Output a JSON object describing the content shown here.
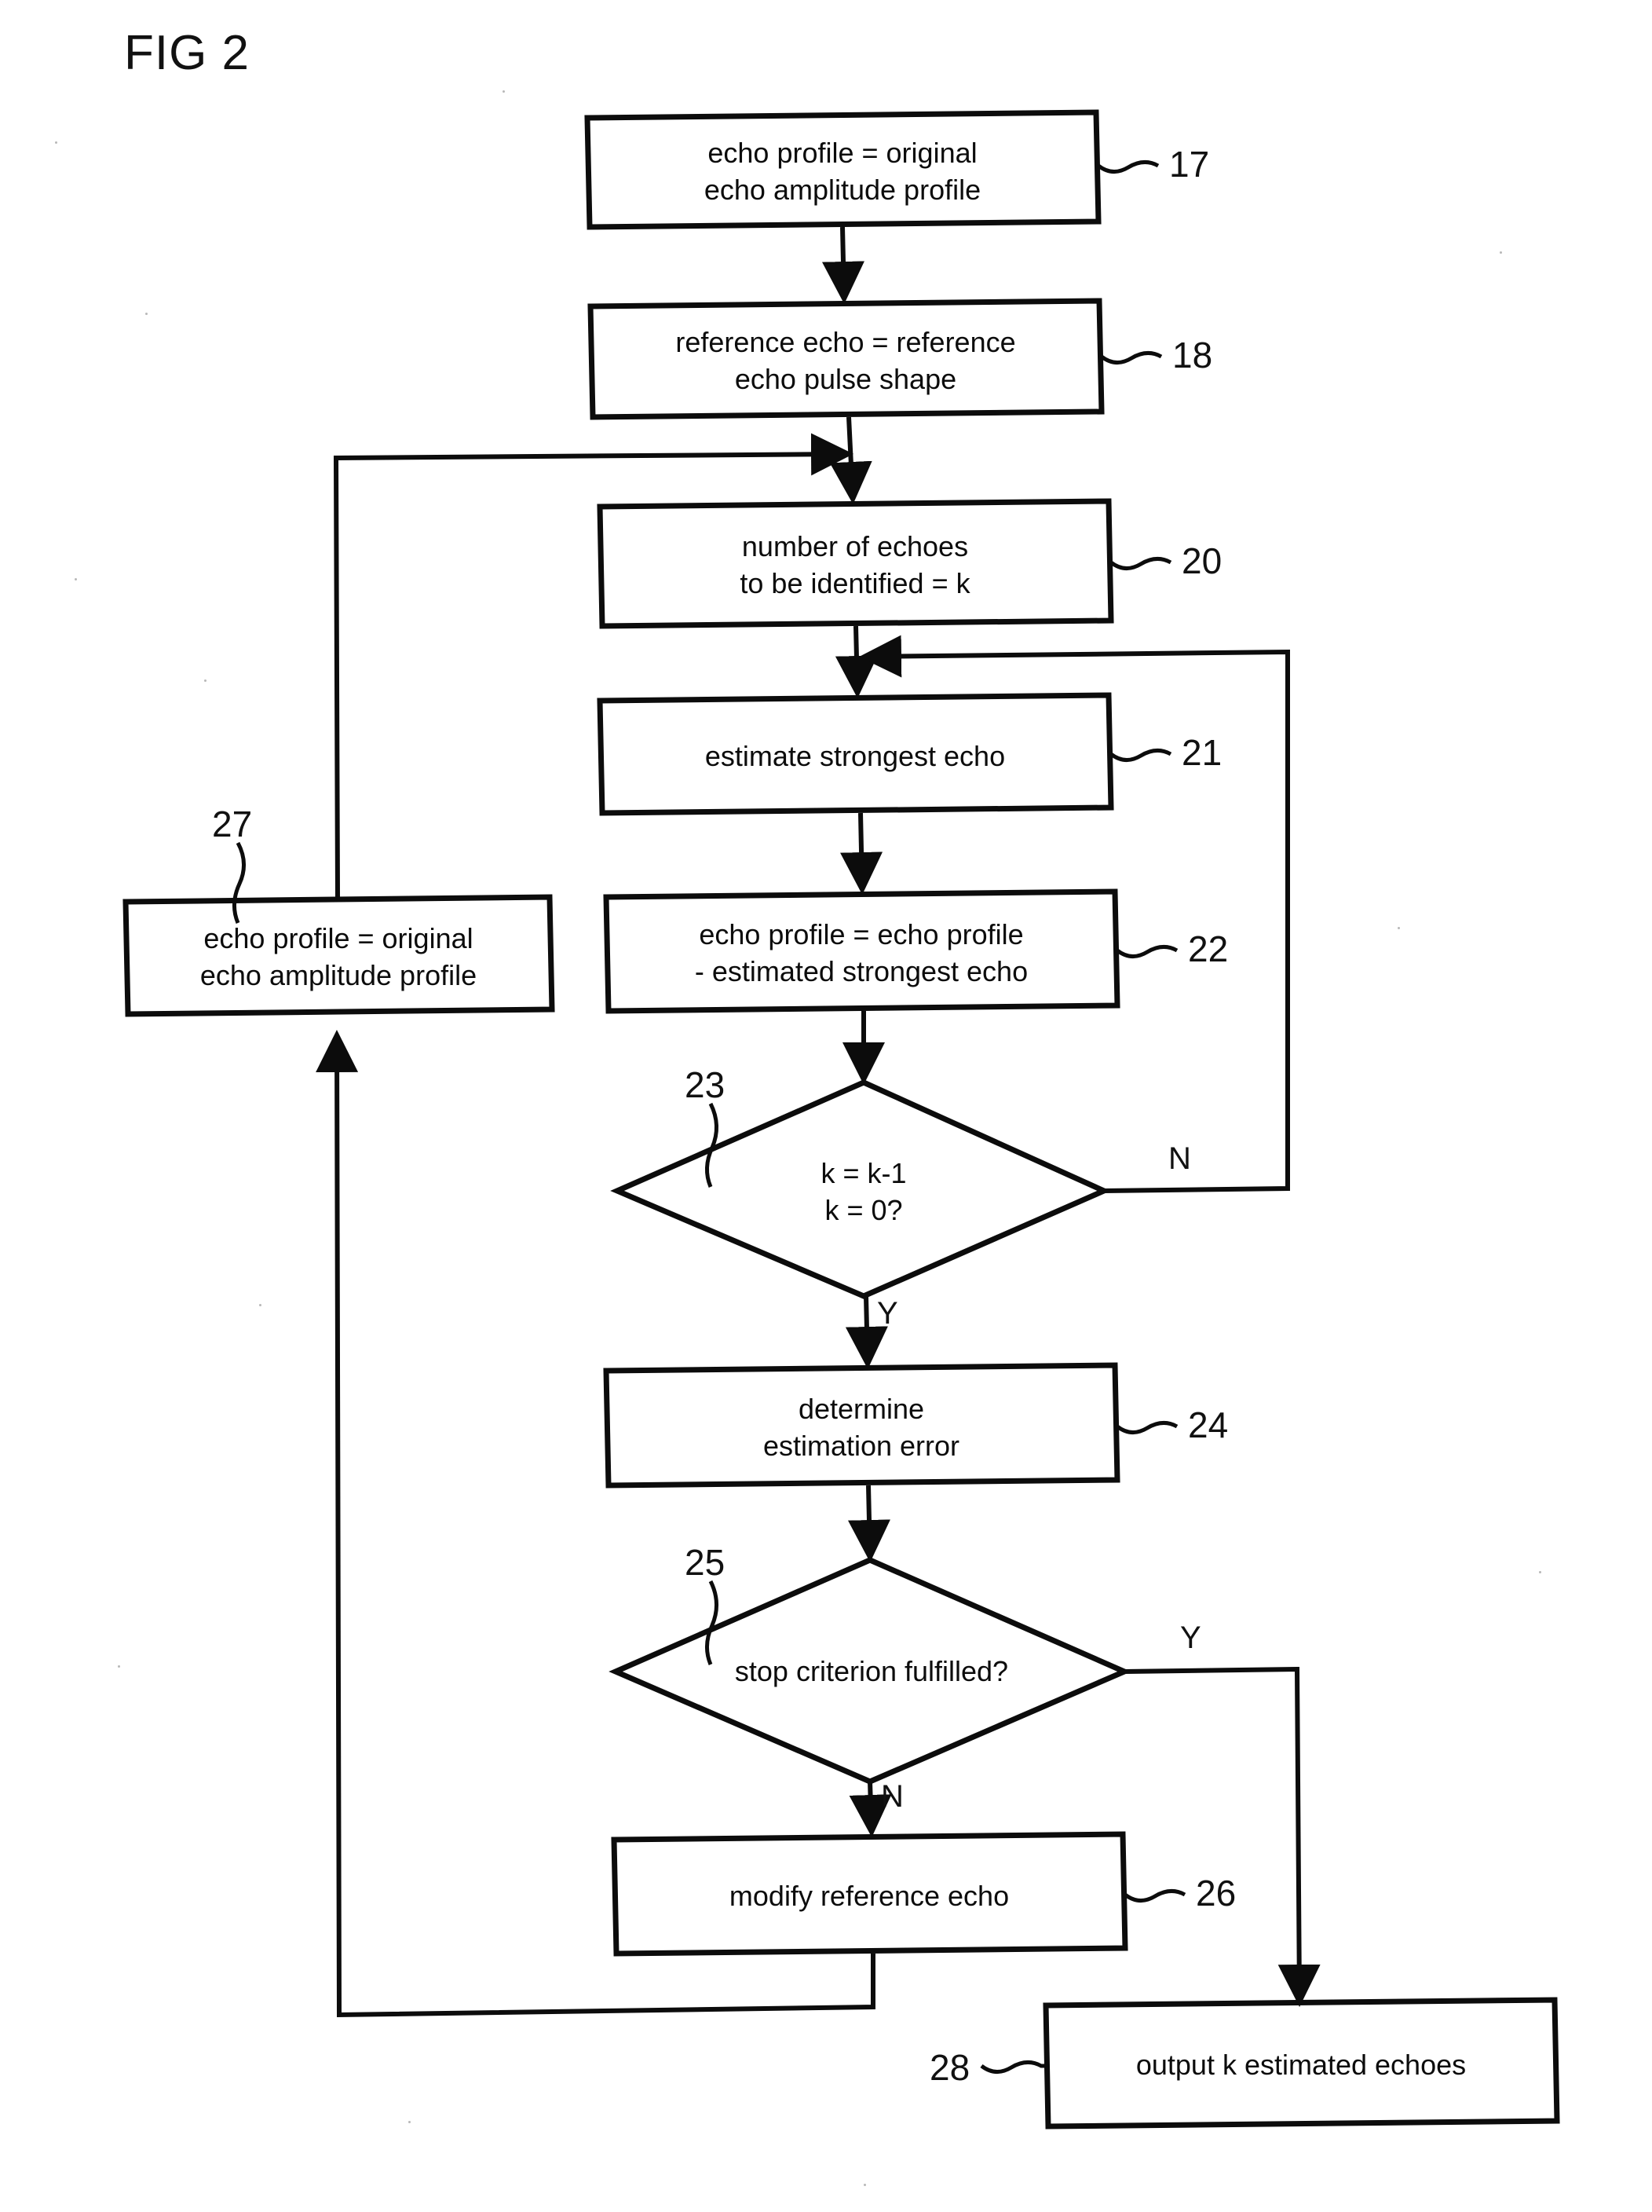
{
  "figure": {
    "title": "FIG 2",
    "type": "flowchart"
  },
  "nodes": [
    {
      "id": "17",
      "shape": "process",
      "ref": "17",
      "lines": [
        "echo profile = original",
        "echo amplitude profile"
      ]
    },
    {
      "id": "18",
      "shape": "process",
      "ref": "18",
      "lines": [
        "reference echo = reference",
        "echo pulse shape"
      ]
    },
    {
      "id": "20",
      "shape": "process",
      "ref": "20",
      "lines": [
        "number of echoes",
        "to be identified = k"
      ]
    },
    {
      "id": "21",
      "shape": "process",
      "ref": "21",
      "lines": [
        "estimate strongest echo"
      ]
    },
    {
      "id": "22",
      "shape": "process",
      "ref": "22",
      "lines": [
        "echo profile = echo profile",
        "- estimated strongest echo"
      ]
    },
    {
      "id": "27",
      "shape": "process",
      "ref": "27",
      "lines": [
        "echo profile = original",
        "echo amplitude profile"
      ]
    },
    {
      "id": "23",
      "shape": "decision",
      "ref": "23",
      "lines": [
        "k = k-1",
        "k = 0?"
      ]
    },
    {
      "id": "24",
      "shape": "process",
      "ref": "24",
      "lines": [
        "determine",
        "estimation error"
      ]
    },
    {
      "id": "25",
      "shape": "decision",
      "ref": "25",
      "lines": [
        "stop criterion fulfilled?"
      ]
    },
    {
      "id": "26",
      "shape": "process",
      "ref": "26",
      "lines": [
        "modify reference echo"
      ]
    },
    {
      "id": "28",
      "shape": "process",
      "ref": "28",
      "lines": [
        "output k estimated echoes"
      ]
    }
  ],
  "branch_labels": {
    "d23_no": "N",
    "d23_yes": "Y",
    "d25_yes": "Y",
    "d25_no": "N"
  },
  "colors": {
    "ink": "#0c0c0c",
    "paper": "#ffffff"
  }
}
